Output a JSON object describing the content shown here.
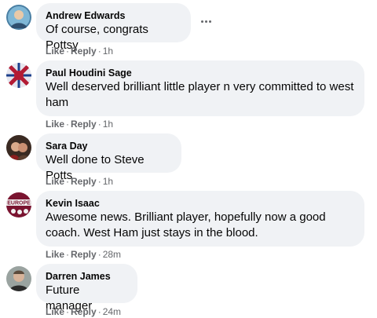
{
  "comments": [
    {
      "author": "Andrew Edwards",
      "text": "Of course, congrats Pottsy",
      "like_label": "Like",
      "reply_label": "Reply",
      "time": "1h",
      "avatar_icon": "user-avatar"
    },
    {
      "author": "Paul Houdini Sage",
      "text": "Well deserved brilliant little player n very committed to west ham",
      "like_label": "Like",
      "reply_label": "Reply",
      "time": "1h",
      "avatar_icon": "user-avatar"
    },
    {
      "author": "Sara Day",
      "text": "Well done to Steve Potts",
      "like_label": "Like",
      "reply_label": "Reply",
      "time": "1h",
      "avatar_icon": "user-avatar"
    },
    {
      "author": "Kevin Isaac",
      "text": "Awesome news. Brilliant player, hopefully now a good coach. West Ham just stays in the blood.",
      "like_label": "Like",
      "reply_label": "Reply",
      "time": "28m",
      "avatar_icon": "user-avatar",
      "avatar_text": "EUROPE"
    },
    {
      "author": "Darren James",
      "text": "Future manager",
      "like_label": "Like",
      "reply_label": "Reply",
      "time": "24m",
      "avatar_icon": "user-avatar"
    }
  ],
  "more_options_icon": "more-horizontal-icon",
  "colors": {
    "bubble": "#f0f2f5",
    "meta": "#65676b",
    "text": "#050505"
  }
}
